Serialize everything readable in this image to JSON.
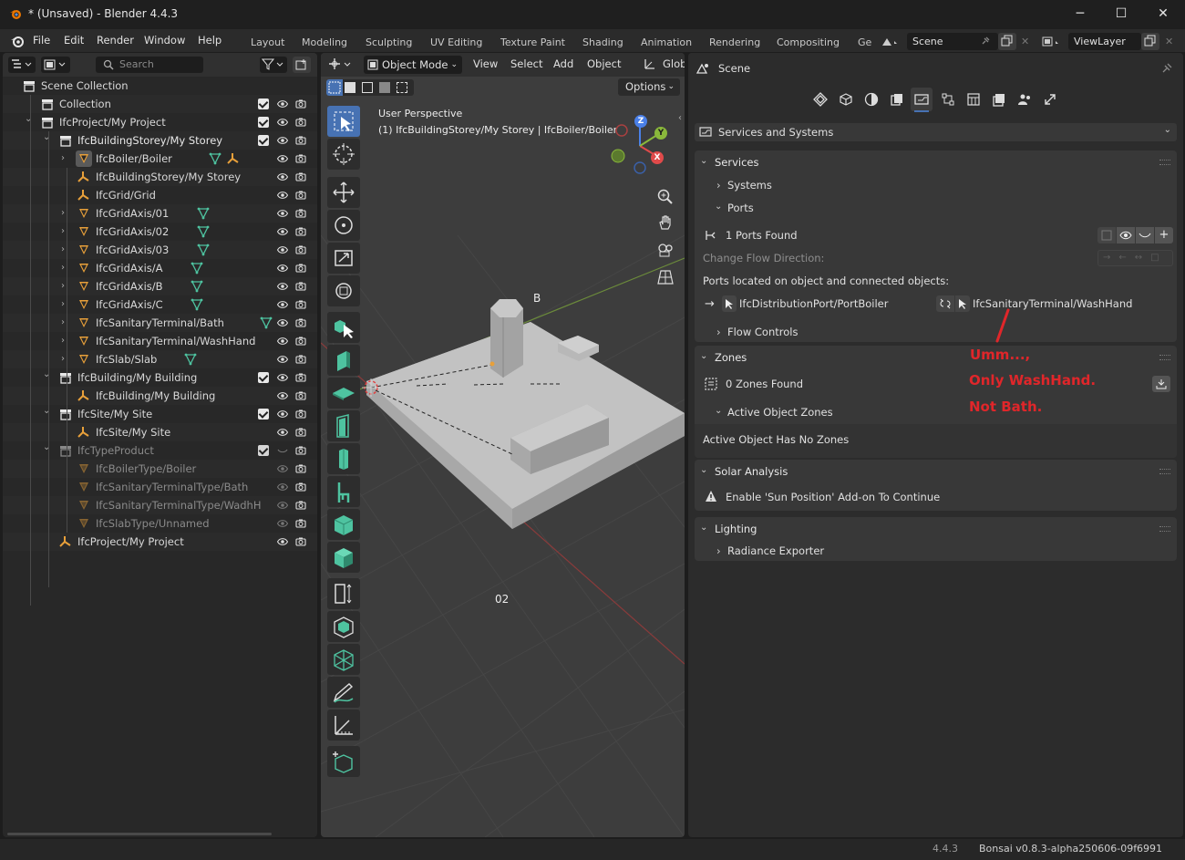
{
  "window": {
    "title": "* (Unsaved) - Blender 4.4.3",
    "minimize": "─",
    "maximize": "☐",
    "close": "✕"
  },
  "menubar": {
    "menus": [
      "File",
      "Edit",
      "Render",
      "Window",
      "Help"
    ],
    "workspaces": [
      "Layout",
      "Modeling",
      "Sculpting",
      "UV Editing",
      "Texture Paint",
      "Shading",
      "Animation",
      "Rendering",
      "Compositing",
      "Ge"
    ],
    "scene": "Scene",
    "view_layer": "ViewLayer"
  },
  "outliner": {
    "search_placeholder": "Search",
    "rows": [
      {
        "label": "Scene Collection",
        "indent": 0,
        "icon": "collection-icon",
        "chevron": "",
        "checkbox": false,
        "eye": false
      },
      {
        "label": "Collection",
        "indent": 1,
        "icon": "collection-icon",
        "chevron": "",
        "checkbox": true,
        "eye": true
      },
      {
        "label": "IfcProject/My Project",
        "indent": 1,
        "icon": "collection-icon",
        "chevron": "down",
        "checkbox": true,
        "eye": true
      },
      {
        "label": "IfcBuildingStorey/My Storey",
        "indent": 2,
        "icon": "collection-icon",
        "chevron": "down",
        "checkbox": true,
        "eye": true,
        "bold": true
      },
      {
        "label": "IfcBoiler/Boiler",
        "indent": 3,
        "icon": "mesh-icon",
        "chevron": "right",
        "checkbox": false,
        "eye": true,
        "extra": [
          "mesh-data-icon",
          "empty-icon"
        ],
        "selected": true
      },
      {
        "label": "IfcBuildingStorey/My Storey",
        "indent": 3,
        "icon": "empty-icon",
        "chevron": "",
        "checkbox": false,
        "eye": true
      },
      {
        "label": "IfcGrid/Grid",
        "indent": 3,
        "icon": "empty-icon",
        "chevron": "",
        "checkbox": false,
        "eye": true
      },
      {
        "label": "IfcGridAxis/01",
        "indent": 3,
        "icon": "mesh-icon",
        "chevron": "right",
        "checkbox": false,
        "eye": true,
        "extra": [
          "mesh-data-icon"
        ]
      },
      {
        "label": "IfcGridAxis/02",
        "indent": 3,
        "icon": "mesh-icon",
        "chevron": "right",
        "checkbox": false,
        "eye": true,
        "extra": [
          "mesh-data-icon"
        ]
      },
      {
        "label": "IfcGridAxis/03",
        "indent": 3,
        "icon": "mesh-icon",
        "chevron": "right",
        "checkbox": false,
        "eye": true,
        "extra": [
          "mesh-data-icon"
        ]
      },
      {
        "label": "IfcGridAxis/A",
        "indent": 3,
        "icon": "mesh-icon",
        "chevron": "right",
        "checkbox": false,
        "eye": true,
        "extra": [
          "mesh-data-icon"
        ]
      },
      {
        "label": "IfcGridAxis/B",
        "indent": 3,
        "icon": "mesh-icon",
        "chevron": "right",
        "checkbox": false,
        "eye": true,
        "extra": [
          "mesh-data-icon"
        ]
      },
      {
        "label": "IfcGridAxis/C",
        "indent": 3,
        "icon": "mesh-icon",
        "chevron": "right",
        "checkbox": false,
        "eye": true,
        "extra": [
          "mesh-data-icon"
        ]
      },
      {
        "label": "IfcSanitaryTerminal/Bath",
        "indent": 3,
        "icon": "mesh-icon",
        "chevron": "right",
        "checkbox": false,
        "eye": true,
        "extra": [
          "mesh-data-icon"
        ]
      },
      {
        "label": "IfcSanitaryTerminal/WashHand",
        "indent": 3,
        "icon": "mesh-icon",
        "chevron": "right",
        "checkbox": false,
        "eye": true
      },
      {
        "label": "IfcSlab/Slab",
        "indent": 3,
        "icon": "mesh-icon",
        "chevron": "right",
        "checkbox": false,
        "eye": true,
        "extra": [
          "mesh-data-icon"
        ]
      },
      {
        "label": "IfcBuilding/My Building",
        "indent": 2,
        "icon": "collection-icon",
        "chevron": "down",
        "checkbox": true,
        "eye": true
      },
      {
        "label": "IfcBuilding/My Building",
        "indent": 3,
        "icon": "empty-icon",
        "chevron": "",
        "checkbox": false,
        "eye": true
      },
      {
        "label": "IfcSite/My Site",
        "indent": 2,
        "icon": "collection-icon",
        "chevron": "down",
        "checkbox": true,
        "eye": true
      },
      {
        "label": "IfcSite/My Site",
        "indent": 3,
        "icon": "empty-icon",
        "chevron": "",
        "checkbox": false,
        "eye": true
      },
      {
        "label": "IfcTypeProduct",
        "indent": 2,
        "icon": "collection-icon",
        "chevron": "down",
        "checkbox": true,
        "eye": false,
        "dim": true
      },
      {
        "label": "IfcBoilerType/Boiler",
        "indent": 3,
        "icon": "mesh-icon",
        "chevron": "",
        "checkbox": false,
        "eye": true,
        "dim": true
      },
      {
        "label": "IfcSanitaryTerminalType/Bath",
        "indent": 3,
        "icon": "mesh-icon",
        "chevron": "",
        "checkbox": false,
        "eye": true,
        "dim": true
      },
      {
        "label": "IfcSanitaryTerminalType/WadhH",
        "indent": 3,
        "icon": "mesh-icon",
        "chevron": "",
        "checkbox": false,
        "eye": true,
        "dim": true
      },
      {
        "label": "IfcSlabType/Unnamed",
        "indent": 3,
        "icon": "mesh-icon",
        "chevron": "",
        "checkbox": false,
        "eye": true,
        "dim": true
      },
      {
        "label": "IfcProject/My Project",
        "indent": 2,
        "icon": "empty-icon",
        "chevron": "",
        "checkbox": false,
        "eye": true
      }
    ]
  },
  "viewport": {
    "mode": "Object Mode",
    "menus": [
      "View",
      "Select",
      "Add",
      "Object"
    ],
    "orientation": "Glob",
    "options": "Options",
    "info_line1": "User Perspective",
    "info_line2": "(1) IfcBuildingStorey/My Storey | IfcBoiler/Boiler",
    "grid_label_b": "B",
    "grid_label_02": "02",
    "gizmo": {
      "x": "X",
      "y": "Y",
      "z": "Z"
    }
  },
  "properties": {
    "context": "Scene",
    "section_dropdown": "Services and Systems",
    "services": {
      "title": "Services",
      "systems": "Systems",
      "ports": "Ports",
      "ports_found": "1 Ports Found",
      "change_flow": "Change Flow Direction:",
      "located": "Ports located on object and connected objects:",
      "port_name": "IfcDistributionPort/PortBoiler",
      "connected": "IfcSanitaryTerminal/WashHand",
      "flow_controls": "Flow Controls"
    },
    "zones": {
      "title": "Zones",
      "zones_found": "0 Zones Found",
      "active_object_zones": "Active Object Zones",
      "no_zones": "Active Object Has No Zones"
    },
    "solar": {
      "title": "Solar Analysis",
      "warning": "Enable 'Sun Position' Add-on To Continue"
    },
    "lighting": {
      "title": "Lighting",
      "radiance": "Radiance Exporter"
    }
  },
  "annotation": {
    "line1": "Umm...,",
    "line2": "Only WashHand.",
    "line3": "Not Bath.",
    "color": "#e0262a"
  },
  "statusbar": {
    "version": "4.4.3",
    "addon": "Bonsai v0.8.3-alpha250606-09f6991"
  }
}
